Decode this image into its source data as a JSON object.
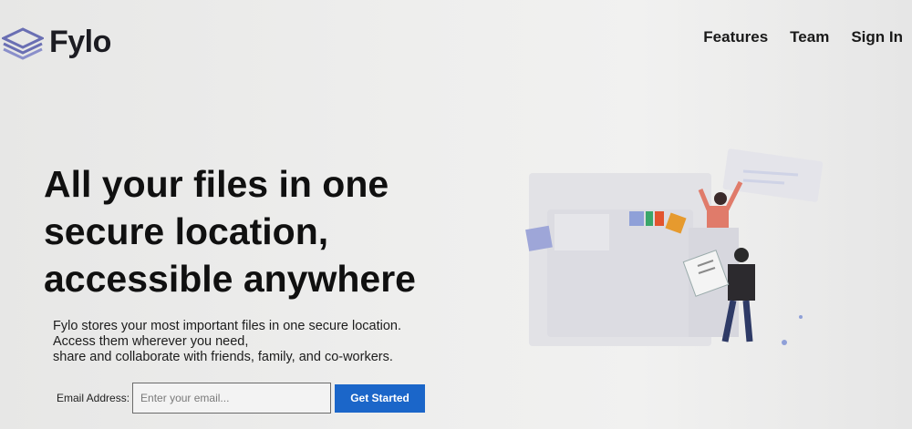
{
  "brand": {
    "name": "Fylo",
    "logo_icon": "stacked-layers-icon",
    "accent": "#6a6fb3"
  },
  "nav": {
    "items": [
      {
        "label": "Features"
      },
      {
        "label": "Team"
      },
      {
        "label": "Sign In"
      }
    ]
  },
  "hero": {
    "title": "All your files in one secure location, accessible anywhere",
    "subtitle_lines": [
      "Fylo stores your most important files in one secure location.",
      "Access them wherever you need,",
      "share and collaborate with friends, family, and co-workers."
    ]
  },
  "signup": {
    "label": "Email Address:",
    "placeholder": "Enter your email...",
    "button": "Get Started",
    "button_color": "#1b66c9"
  },
  "illustration": {
    "icon": "people-with-files-illustration"
  }
}
